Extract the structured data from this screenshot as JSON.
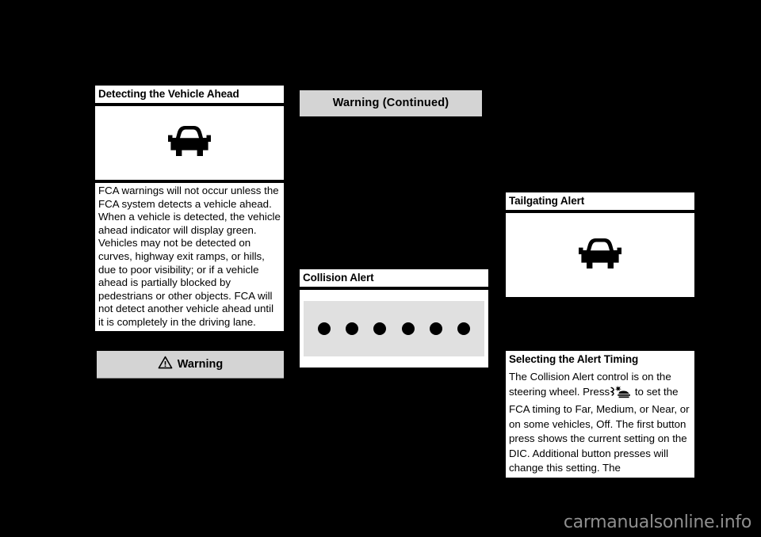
{
  "page": {
    "background_color": "#000000",
    "box_color": "#ffffff",
    "warning_bar_color": "#d4d4d4",
    "gray_band_color": "#e0e0e0",
    "watermark": "carmanualsonline.info"
  },
  "column1": {
    "section1": {
      "heading": "Detecting the Vehicle Ahead",
      "figure_icon": "vehicle-ahead-indicator-icon",
      "body": "FCA warnings will not occur unless the FCA system detects a vehicle ahead. When a vehicle is detected, the vehicle ahead indicator will display green. Vehicles may not be detected on curves, highway exit ramps, or hills, due to poor visibility; or if a vehicle ahead is partially blocked by pedestrians or other objects. FCA will not detect another vehicle ahead until it is completely in the driving lane."
    },
    "warning_bar": {
      "icon": "warning-triangle-icon",
      "label": "Warning"
    }
  },
  "column2": {
    "warning_continued": {
      "label": "Warning  (Continued)"
    },
    "section1": {
      "heading": "Collision Alert",
      "figure_icon": "collision-alert-flashing-dots-icon",
      "dot_count": 6
    }
  },
  "column3": {
    "section1": {
      "heading": "Tailgating Alert",
      "figure_icon": "tailgating-alert-vehicle-icon"
    },
    "section2": {
      "heading": "Selecting the Alert Timing",
      "body_part1": "The Collision Alert control is on the steering wheel. Press",
      "inline_icon": "collision-alert-button-icon",
      "body_part2": "to set the FCA timing to Far, Medium, or Near, or on some vehicles, Off. The first button press shows the current setting on the DIC. Additional button presses will change this setting. The"
    }
  }
}
